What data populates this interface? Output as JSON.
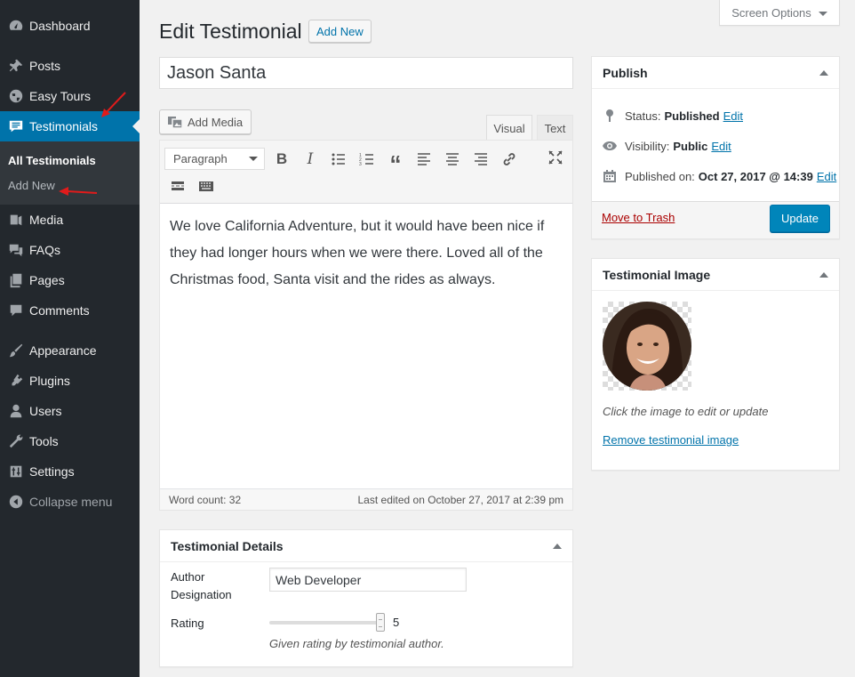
{
  "sidebar": {
    "items": [
      {
        "label": "Dashboard",
        "icon": "dashboard-icon"
      },
      {
        "label": "Posts",
        "icon": "pin-icon"
      },
      {
        "label": "Easy Tours",
        "icon": "globe-icon"
      },
      {
        "label": "Testimonials",
        "icon": "testimonial-icon"
      },
      {
        "label": "Media",
        "icon": "media-icon"
      },
      {
        "label": "FAQs",
        "icon": "faq-icon"
      },
      {
        "label": "Pages",
        "icon": "pages-icon"
      },
      {
        "label": "Comments",
        "icon": "comments-icon"
      },
      {
        "label": "Appearance",
        "icon": "brush-icon"
      },
      {
        "label": "Plugins",
        "icon": "plugin-icon"
      },
      {
        "label": "Users",
        "icon": "users-icon"
      },
      {
        "label": "Tools",
        "icon": "wrench-icon"
      },
      {
        "label": "Settings",
        "icon": "settings-icon"
      },
      {
        "label": "Collapse menu",
        "icon": "collapse-icon"
      }
    ],
    "submenu": [
      "All Testimonials",
      "Add New"
    ]
  },
  "header": {
    "title": "Edit Testimonial",
    "add_new": "Add New",
    "screen_options": "Screen Options"
  },
  "post": {
    "title": "Jason Santa",
    "add_media": "Add Media",
    "tab_visual": "Visual",
    "tab_text": "Text",
    "format": "Paragraph",
    "content": "We love California Adventure, but it would have been nice if they had longer hours when we were there. Loved all of the Christmas food, Santa visit and the rides as always.",
    "word_count": "Word count: 32",
    "last_edited": "Last edited on October 27, 2017 at 2:39 pm"
  },
  "details": {
    "title": "Testimonial Details",
    "designation_label": "Author Designation",
    "designation_value": "Web Developer",
    "rating_label": "Rating",
    "rating_value": "5",
    "rating_fraction": 1.0,
    "rating_help": "Given rating by testimonial author."
  },
  "publish": {
    "title": "Publish",
    "status_label": "Status:",
    "status_value": "Published",
    "visibility_label": "Visibility:",
    "visibility_value": "Public",
    "published_label": "Published on:",
    "published_value": "Oct 27, 2017 @ 14:39",
    "edit": "Edit",
    "trash": "Move to Trash",
    "update": "Update"
  },
  "image_box": {
    "title": "Testimonial Image",
    "caption": "Click the image to edit or update",
    "remove": "Remove testimonial image"
  },
  "colors": {
    "sidebar_bg": "#23282d",
    "accent": "#0073aa",
    "primary_button": "#0085ba",
    "trash": "#a00",
    "annotation_arrow": "#e01b1b"
  }
}
